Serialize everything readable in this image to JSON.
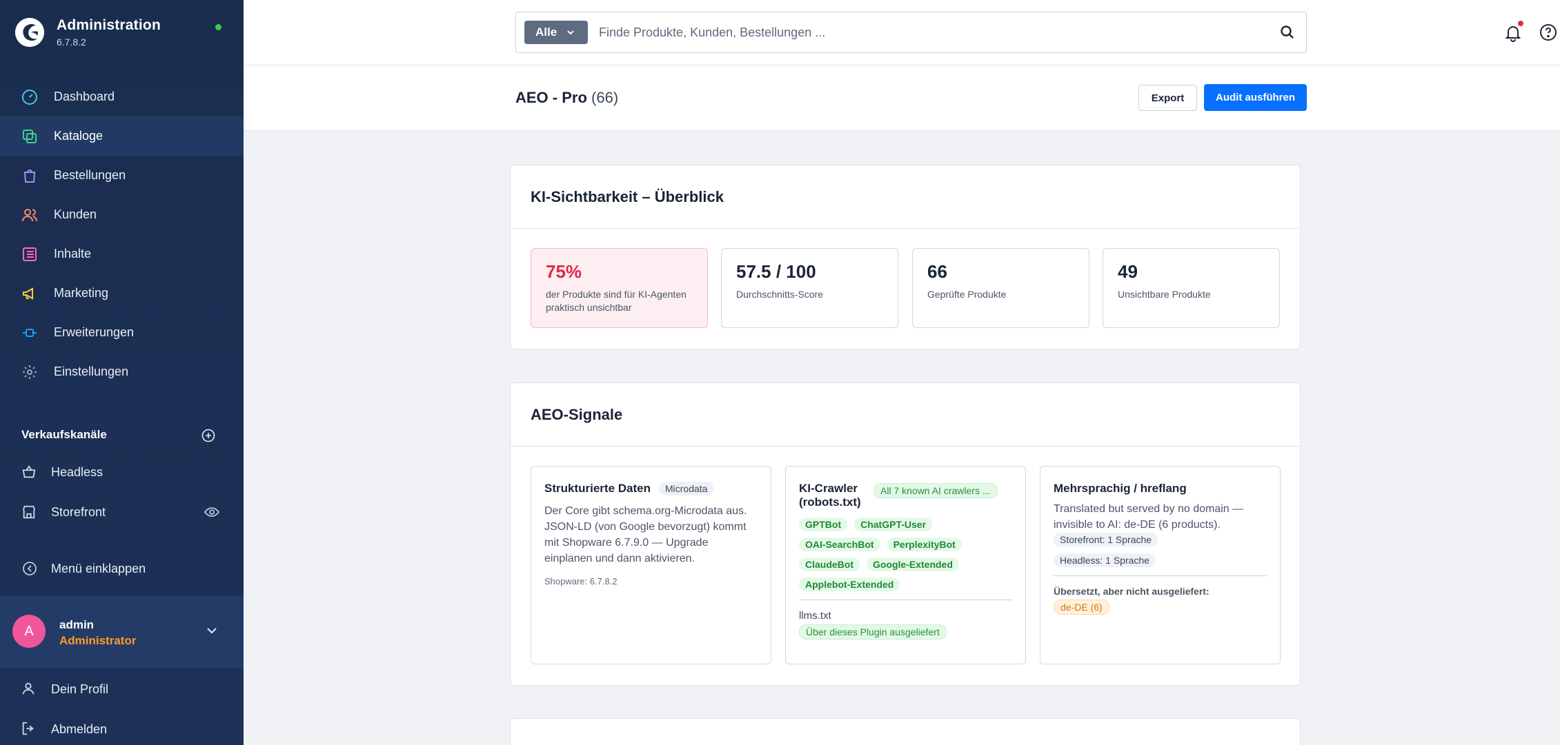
{
  "app": {
    "title": "Administration",
    "version": "6.7.8.2"
  },
  "nav": {
    "items": [
      {
        "label": "Dashboard",
        "icon": "gauge-icon",
        "color": "#4fc1e9"
      },
      {
        "label": "Kataloge",
        "icon": "catalog-icon",
        "color": "#42d08c"
      },
      {
        "label": "Bestellungen",
        "icon": "shopping-bag-icon",
        "color": "#a28ff4"
      },
      {
        "label": "Kunden",
        "icon": "users-icon",
        "color": "#f88962"
      },
      {
        "label": "Inhalte",
        "icon": "content-icon",
        "color": "#ff68b4"
      },
      {
        "label": "Marketing",
        "icon": "megaphone-icon",
        "color": "#ffd232"
      },
      {
        "label": "Erweiterungen",
        "icon": "plug-icon",
        "color": "#189eff"
      },
      {
        "label": "Einstellungen",
        "icon": "gear-icon",
        "color": "#9aa8bc"
      }
    ],
    "active": "Kataloge"
  },
  "channels": {
    "title": "Verkaufskanäle",
    "items": [
      {
        "label": "Headless",
        "icon": "basket-icon"
      },
      {
        "label": "Storefront",
        "icon": "storefront-icon"
      }
    ]
  },
  "collapse_label": "Menü einklappen",
  "user": {
    "initial": "A",
    "name": "admin",
    "role": "Administrator"
  },
  "footer": {
    "profile": "Dein Profil",
    "logout": "Abmelden"
  },
  "search": {
    "scope": "Alle",
    "placeholder": "Finde Produkte, Kunden, Bestellungen ..."
  },
  "page": {
    "title": "AEO - Pro",
    "count": "(66)",
    "export": "Export",
    "audit": "Audit ausführen"
  },
  "overview": {
    "title": "KI-Sichtbarkeit – Überblick",
    "stats": [
      {
        "value": "75%",
        "label": "der Produkte sind für KI-Agenten praktisch unsichtbar"
      },
      {
        "value": "57.5 / 100",
        "label": "Durchschnitts-Score"
      },
      {
        "value": "66",
        "label": "Geprüfte Produkte"
      },
      {
        "value": "49",
        "label": "Unsichtbare Produkte"
      }
    ]
  },
  "signals": {
    "title": "AEO-Signale",
    "structured": {
      "title": "Strukturierte Daten",
      "badge": "Microdata",
      "text": "Der Core gibt schema.org-Microdata aus. JSON-LD (von Google bevorzugt) kommt mit Shopware 6.7.9.0 — Upgrade einplanen und dann aktivieren.",
      "version": "Shopware: 6.7.8.2"
    },
    "crawler": {
      "title": "KI-Crawler (robots.txt)",
      "badge": "All 7 known AI crawlers ...",
      "bots": [
        "GPTBot",
        "ChatGPT-User",
        "OAI-SearchBot",
        "PerplexityBot",
        "ClaudeBot",
        "Google-Extended",
        "Applebot-Extended"
      ],
      "llms_label": "llms.txt",
      "llms_status": "Über dieses Plugin ausgeliefert"
    },
    "multilang": {
      "title": "Mehrsprachig / hreflang",
      "text": "Translated but served by no domain — invisible to AI: de-DE (6 products).",
      "storefront": "Storefront: 1 Sprache",
      "headless": "Headless: 1 Sprache",
      "translated_label": "Übersetzt, aber nicht ausgeliefert:",
      "translated_value": "de-DE (6)"
    }
  }
}
